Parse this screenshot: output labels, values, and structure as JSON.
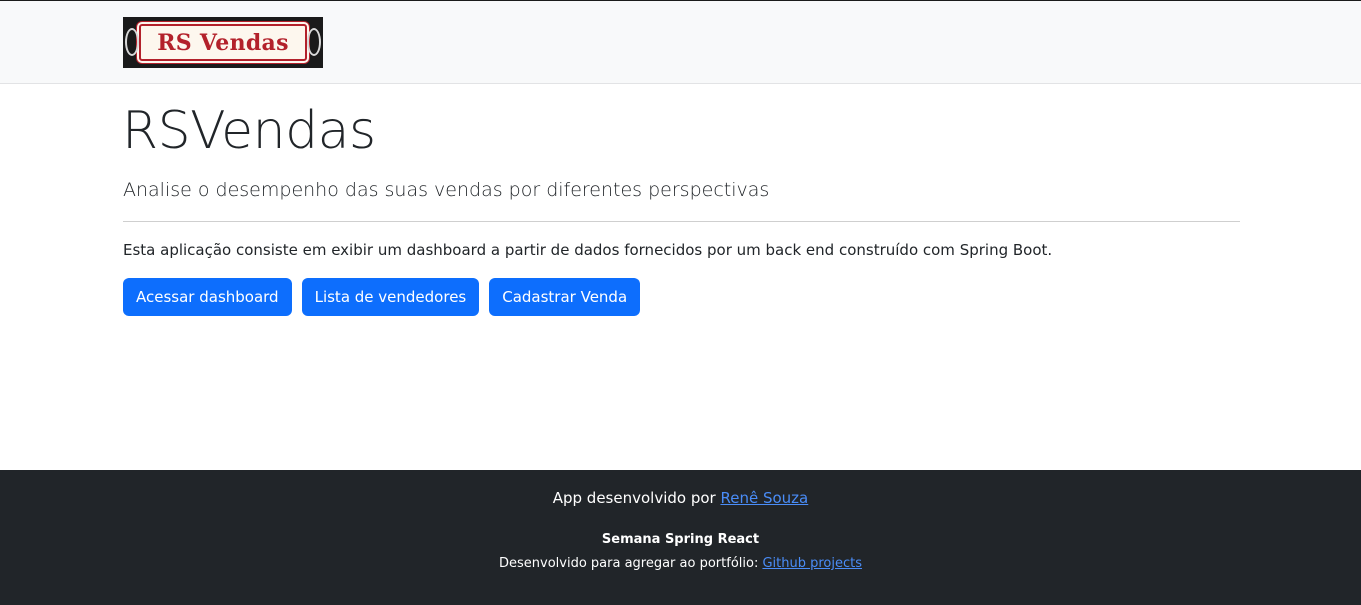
{
  "navbar": {
    "logo_text": "RS Vendas"
  },
  "hero": {
    "title": "RSVendas",
    "subtitle": "Analise o desempenho das suas vendas por diferentes perspectivas",
    "description": "Esta aplicação consiste em exibir um dashboard a partir de dados fornecidos por um back end construído com Spring Boot."
  },
  "buttons": {
    "dashboard": "Acessar dashboard",
    "sellers": "Lista de vendedores",
    "register_sale": "Cadastrar Venda"
  },
  "footer": {
    "developed_by_prefix": "App desenvolvido por ",
    "developer_link": "Renê Souza",
    "event_title": "Semana Spring React",
    "portfolio_prefix": "Desenvolvido para agregar ao portfólio: ",
    "portfolio_link": "Github projects"
  },
  "colors": {
    "primary": "#0d6efd",
    "navbar_bg": "#f8f9fa",
    "footer_bg": "#212529",
    "link": "#4a8df8",
    "logo_red": "#b3212b"
  }
}
